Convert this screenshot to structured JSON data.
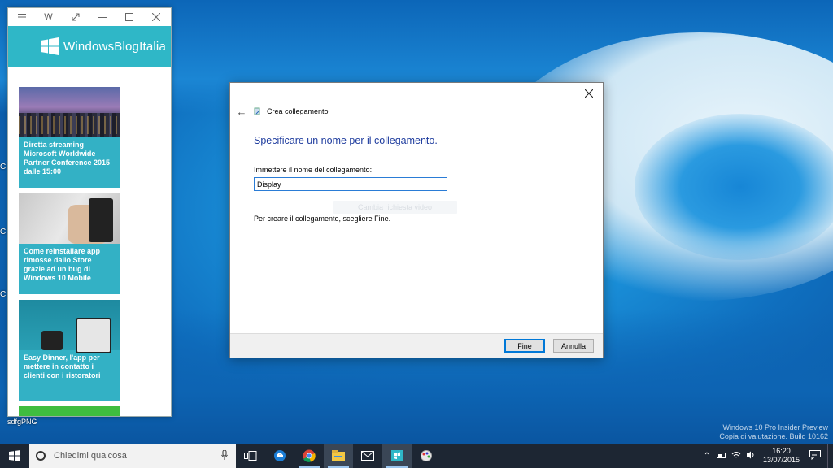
{
  "app_window": {
    "title_icon": "W",
    "brand": "WindowsBlogItalia",
    "articles": [
      {
        "title": "Diretta streaming Microsoft Worldwide Partner Conference 2015 dalle 15:00"
      },
      {
        "title": "Come reinstallare app rimosse dallo Store grazie ad un bug di Windows 10 Mobile"
      },
      {
        "title": "Easy Dinner, l'app per mettere in contatto i clienti con i ristoratori"
      }
    ]
  },
  "desktop": {
    "icon_label": "sdfgPNG",
    "watermark": [
      "Windows 10 Pro Insider Preview",
      "Copia di valutazione. Build 10162"
    ]
  },
  "dialog": {
    "wizard_title": "Crea collegamento",
    "heading": "Specificare un nome per il collegamento.",
    "field_label": "Immettere il nome del collegamento:",
    "field_value": "Display",
    "hidden_button": "Cambia richiesta video",
    "instruction": "Per creare il collegamento, scegliere Fine.",
    "finish_button": "Fine",
    "cancel_button": "Annulla"
  },
  "taskbar": {
    "search_placeholder": "Chiedimi qualcosa",
    "time": "16:20",
    "date": "13/07/2015",
    "icons": [
      "task-view-icon",
      "edge-icon",
      "chrome-icon",
      "file-explorer-icon",
      "mail-icon",
      "windowsblogitalia-app-icon",
      "paint-icon"
    ]
  },
  "colors": {
    "accent": "#2fb7c7",
    "dialog_heading": "#1e3c9e",
    "taskbar": "#1d2633"
  }
}
